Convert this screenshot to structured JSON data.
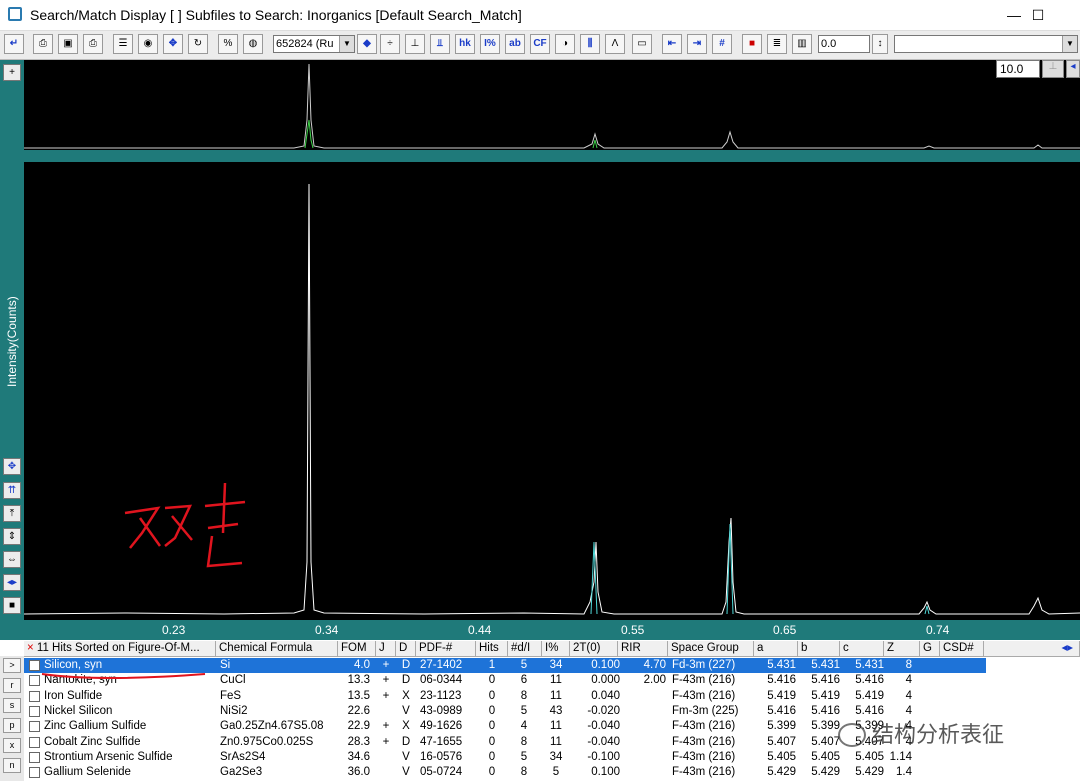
{
  "window": {
    "title": "Search/Match Display [ ] Subfiles to Search: Inorganics [Default Search_Match]"
  },
  "toolbar": {
    "pattern_combo": "652824 (Ru",
    "value_field": "0.0",
    "zoom_value": "10.0",
    "buttons": [
      "back-arrow",
      "print",
      "save",
      "printer2",
      "list",
      "camera",
      "move",
      "refresh",
      "scale",
      "globe",
      "color",
      "peaks",
      "peak-label",
      "hkl",
      "i-percent",
      "abc",
      "cf",
      "moon",
      "bars",
      "lambda",
      "frame",
      "align-left",
      "align-right",
      "grid",
      "stop",
      "stack",
      "chart"
    ]
  },
  "plot": {
    "ylabel": "Intensity(Counts)",
    "x_ticks": [
      "0.23",
      "0.34",
      "0.44",
      "0.55",
      "0.65",
      "0.74"
    ],
    "annotation_color": "#e0141e"
  },
  "table": {
    "header_title": "11 Hits Sorted on Figure-Of-M...",
    "columns": [
      "Chemical Formula",
      "FOM",
      "J",
      "D",
      "PDF-#",
      "Hits",
      "#d/I",
      "I%",
      "2T(0)",
      "RIR",
      "Space Group",
      "a",
      "b",
      "c",
      "Z",
      "G",
      "CSD#"
    ],
    "rows": [
      {
        "name": "Silicon, syn",
        "formula": "Si",
        "fom": "4.0",
        "j": "+",
        "d": "D",
        "pdf": "27-1402",
        "hits": "1",
        "di": "5",
        "ip": "34",
        "t2": "0.100",
        "rir": "4.70",
        "sg": "Fd-3m (227)",
        "a": "5.431",
        "b": "5.431",
        "c": "5.431",
        "z": "8"
      },
      {
        "name": "Nantokite, syn",
        "formula": "CuCl",
        "fom": "13.3",
        "j": "+",
        "d": "D",
        "pdf": "06-0344",
        "hits": "0",
        "di": "6",
        "ip": "11",
        "t2": "0.000",
        "rir": "2.00",
        "sg": "F-43m (216)",
        "a": "5.416",
        "b": "5.416",
        "c": "5.416",
        "z": "4"
      },
      {
        "name": "Iron Sulfide",
        "formula": "FeS",
        "fom": "13.5",
        "j": "+",
        "d": "X",
        "pdf": "23-1123",
        "hits": "0",
        "di": "8",
        "ip": "11",
        "t2": "0.040",
        "rir": "",
        "sg": "F-43m (216)",
        "a": "5.419",
        "b": "5.419",
        "c": "5.419",
        "z": "4"
      },
      {
        "name": "Nickel Silicon",
        "formula": "NiSi2",
        "fom": "22.6",
        "j": "",
        "d": "V",
        "pdf": "43-0989",
        "hits": "0",
        "di": "5",
        "ip": "43",
        "t2": "-0.020",
        "rir": "",
        "sg": "Fm-3m (225)",
        "a": "5.416",
        "b": "5.416",
        "c": "5.416",
        "z": "4"
      },
      {
        "name": "Zinc Gallium Sulfide",
        "formula": "Ga0.25Zn4.67S5.08",
        "fom": "22.9",
        "j": "+",
        "d": "X",
        "pdf": "49-1626",
        "hits": "0",
        "di": "4",
        "ip": "11",
        "t2": "-0.040",
        "rir": "",
        "sg": "F-43m (216)",
        "a": "5.399",
        "b": "5.399",
        "c": "5.399",
        "z": "4"
      },
      {
        "name": "Cobalt Zinc Sulfide",
        "formula": "Zn0.975Co0.025S",
        "fom": "28.3",
        "j": "+",
        "d": "D",
        "pdf": "47-1655",
        "hits": "0",
        "di": "8",
        "ip": "11",
        "t2": "-0.040",
        "rir": "",
        "sg": "F-43m (216)",
        "a": "5.407",
        "b": "5.407",
        "c": "5.407",
        "z": "4"
      },
      {
        "name": "Strontium Arsenic Sulfide",
        "formula": "SrAs2S4",
        "fom": "34.6",
        "j": "",
        "d": "V",
        "pdf": "16-0576",
        "hits": "0",
        "di": "5",
        "ip": "34",
        "t2": "-0.100",
        "rir": "",
        "sg": "F-43m (216)",
        "a": "5.405",
        "b": "5.405",
        "c": "5.405",
        "z": "1.14"
      },
      {
        "name": "Gallium Selenide",
        "formula": "Ga2Se3",
        "fom": "36.0",
        "j": "",
        "d": "V",
        "pdf": "05-0724",
        "hits": "0",
        "di": "8",
        "ip": "5",
        "t2": "0.100",
        "rir": "",
        "sg": "F-43m (216)",
        "a": "5.429",
        "b": "5.429",
        "c": "5.429",
        "z": "1.4"
      }
    ]
  },
  "side_buttons": [
    ">",
    "r",
    "s",
    "p",
    "x",
    "n"
  ],
  "watermark": "结构分析表征"
}
